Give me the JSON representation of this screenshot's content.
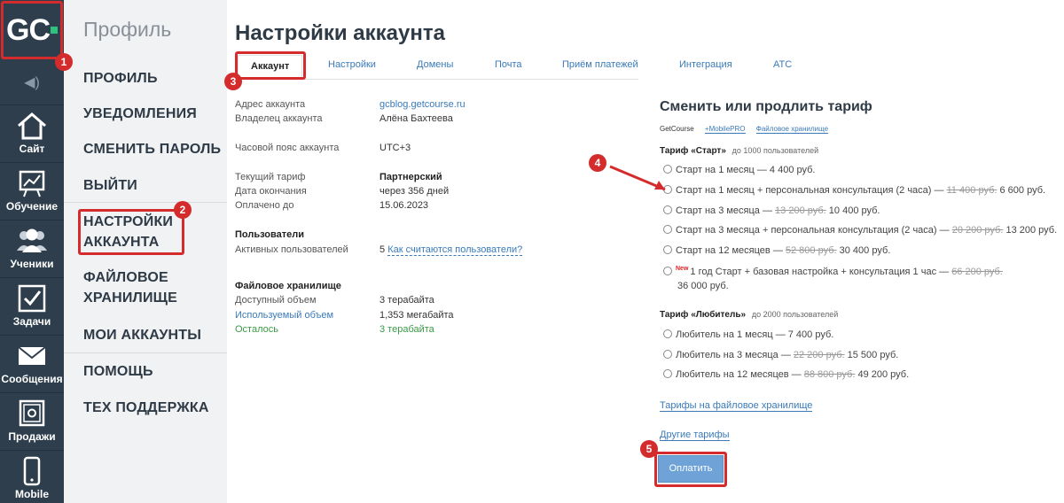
{
  "logo": {
    "text": "GC"
  },
  "iconbar": {
    "items": [
      {
        "label": "Сайт",
        "icon": "home-icon"
      },
      {
        "label": "Обучение",
        "icon": "chart-icon"
      },
      {
        "label": "Ученики",
        "icon": "users-icon"
      },
      {
        "label": "Задачи",
        "icon": "checkbox-icon"
      },
      {
        "label": "Сообщения",
        "icon": "envelope-icon"
      },
      {
        "label": "Продажи",
        "icon": "safe-icon"
      },
      {
        "label": "Mobile",
        "icon": "phone-icon"
      }
    ]
  },
  "profile_menu": {
    "title": "Профиль",
    "items": [
      {
        "label": "ПРОФИЛЬ"
      },
      {
        "label": "УВЕДОМЛЕНИЯ"
      },
      {
        "label": "СМЕНИТЬ ПАРОЛЬ"
      },
      {
        "label": "ВЫЙТИ"
      },
      {
        "label_line1": "НАСТРОЙКИ",
        "label_line2": "АККАУНТА"
      },
      {
        "label_line1": "ФАЙЛОВОЕ",
        "label_line2": "ХРАНИЛИЩЕ"
      },
      {
        "label": "МОИ АККАУНТЫ"
      },
      {
        "label": "ПОМОЩЬ"
      },
      {
        "label": "ТЕХ ПОДДЕРЖКА"
      }
    ]
  },
  "page_title": "Настройки аккаунта",
  "tabs": [
    "Аккаунт",
    "Настройки",
    "Домены",
    "Почта",
    "Приём платежей",
    "Интеграция",
    "АТС"
  ],
  "account": {
    "address_label": "Адрес аккаунта",
    "address_value": "gcblog.getcourse.ru",
    "owner_label": "Владелец аккаунта",
    "owner_value": "Алёна Бахтеева",
    "tz_label": "Часовой пояс аккаунта",
    "tz_value": "UTC+3",
    "tariff_label": "Текущий тариф",
    "tariff_value": "Партнерский",
    "end_label": "Дата окончания",
    "end_value": "через 356 дней",
    "paid_label": "Оплачено до",
    "paid_value": "15.06.2023",
    "users_header": "Пользователи",
    "active_label": "Активных пользователей",
    "active_value": "5",
    "active_link": "Как считаются пользователи?",
    "storage_header": "Файловое хранилище",
    "avail_label": "Доступный объем",
    "avail_value": "3 терабайта",
    "used_label": "Используемый объем",
    "used_value": "1,353 мегабайта",
    "left_label": "Осталось",
    "left_value": "3 терабайта"
  },
  "tariff_panel": {
    "title": "Сменить или продлить тариф",
    "sub": [
      "GetCourse",
      "+MobilePRO",
      "Файловое хранилище"
    ],
    "start_group": {
      "name": "Тариф «Старт»",
      "count": "до 1000 пользователей"
    },
    "start_options": [
      {
        "pre": "Старт на 1 месяц — 4 400 руб.",
        "old": "",
        "price": ""
      },
      {
        "pre": "Старт на 1 месяц + персональная консультация (2 часа) —",
        "old": "11 400 руб.",
        "price": "6 600 руб."
      },
      {
        "pre": "Старт на 3 месяца —",
        "old": "13 200 руб.",
        "price": "10 400 руб."
      },
      {
        "pre": "Старт на 3 месяца + персональная консультация (2 часа) —",
        "old": "20 200 руб.",
        "price": "13 200 руб."
      },
      {
        "pre": "Старт на 12 месяцев —",
        "old": "52 800 руб.",
        "price": "30 400 руб."
      }
    ],
    "special": {
      "badge": "New",
      "pre": "1 год Старт + базовая настройка + консультация 1 час —",
      "old": "66 200 руб.",
      "price": "36 000 руб."
    },
    "amateur_group": {
      "name": "Тариф «Любитель»",
      "count": "до 2000 пользователей"
    },
    "amateur_options": [
      {
        "pre": "Любитель на 1 месяц — 7 400 руб.",
        "old": "",
        "price": ""
      },
      {
        "pre": "Любитель на 3 месяца —",
        "old": "22 200 руб.",
        "price": "15 500 руб."
      },
      {
        "pre": "Любитель на 12 месяцев —",
        "old": "88 800 руб.",
        "price": "49 200 руб."
      }
    ],
    "storage_link": "Тарифы на файловое хранилище",
    "other_link": "Другие тарифы",
    "pay_button": "Оплатить"
  },
  "annotations": [
    "1",
    "2",
    "3",
    "4",
    "5"
  ],
  "colors": {
    "sidebar": "#2e3e4c",
    "accent": "#d42c2c",
    "link": "#3a7ab8"
  }
}
